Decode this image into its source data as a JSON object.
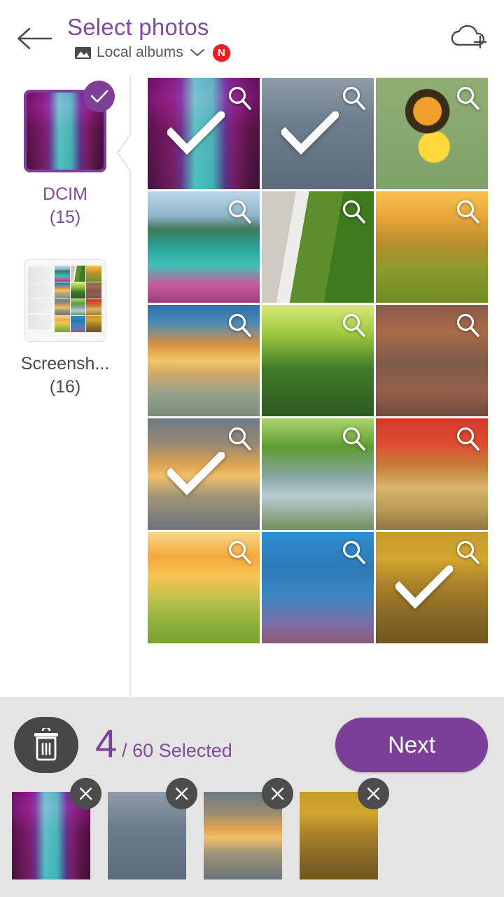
{
  "header": {
    "back_icon": "back-arrow-icon",
    "title": "Select photos",
    "album_source_icon": "photo-album-icon",
    "album_source": "Local albums",
    "chevron_icon": "chevron-down-icon",
    "badge": "N",
    "badge_color": "#E81F1F",
    "cloud_icon": "cloud-add-icon",
    "title_color": "#7E4C9B"
  },
  "sidebar": {
    "albums": [
      {
        "name": "DCIM",
        "count": "(15)",
        "selected": true,
        "art": "ph-canyon"
      },
      {
        "name": "Screensh...",
        "count": "(16)",
        "selected": false,
        "art": "ph-screenshot"
      }
    ]
  },
  "grid": {
    "zoom_icon": "magnifier-icon",
    "check_icon": "check-icon",
    "photos": [
      {
        "art": "ph-canyon",
        "selected": true
      },
      {
        "art": "ph-winter",
        "selected": true
      },
      {
        "art": "ph-butterfly",
        "selected": false
      },
      {
        "art": "ph-lake",
        "selected": false
      },
      {
        "art": "ph-waterfall",
        "selected": false
      },
      {
        "art": "ph-sunhill",
        "selected": false
      },
      {
        "art": "ph-sunsetlake",
        "selected": false
      },
      {
        "art": "ph-peacock",
        "selected": false
      },
      {
        "art": "ph-autumncreek",
        "selected": false
      },
      {
        "art": "ph-pier",
        "selected": true
      },
      {
        "art": "ph-forestriver",
        "selected": false
      },
      {
        "art": "ph-redbridge",
        "selected": false
      },
      {
        "art": "ph-poppy",
        "selected": false
      },
      {
        "art": "ph-bluered",
        "selected": false
      },
      {
        "art": "ph-autumnboard",
        "selected": true
      }
    ]
  },
  "bottom": {
    "trash_icon": "trash-icon",
    "selected_count": "4",
    "count_suffix": "/ 60 Selected",
    "next_label": "Next",
    "next_color": "#7B3F98",
    "remove_icon": "close-icon",
    "selected_thumbs": [
      {
        "art": "ph-canyon"
      },
      {
        "art": "ph-winter"
      },
      {
        "art": "ph-pier"
      },
      {
        "art": "ph-autumnboard"
      }
    ]
  }
}
